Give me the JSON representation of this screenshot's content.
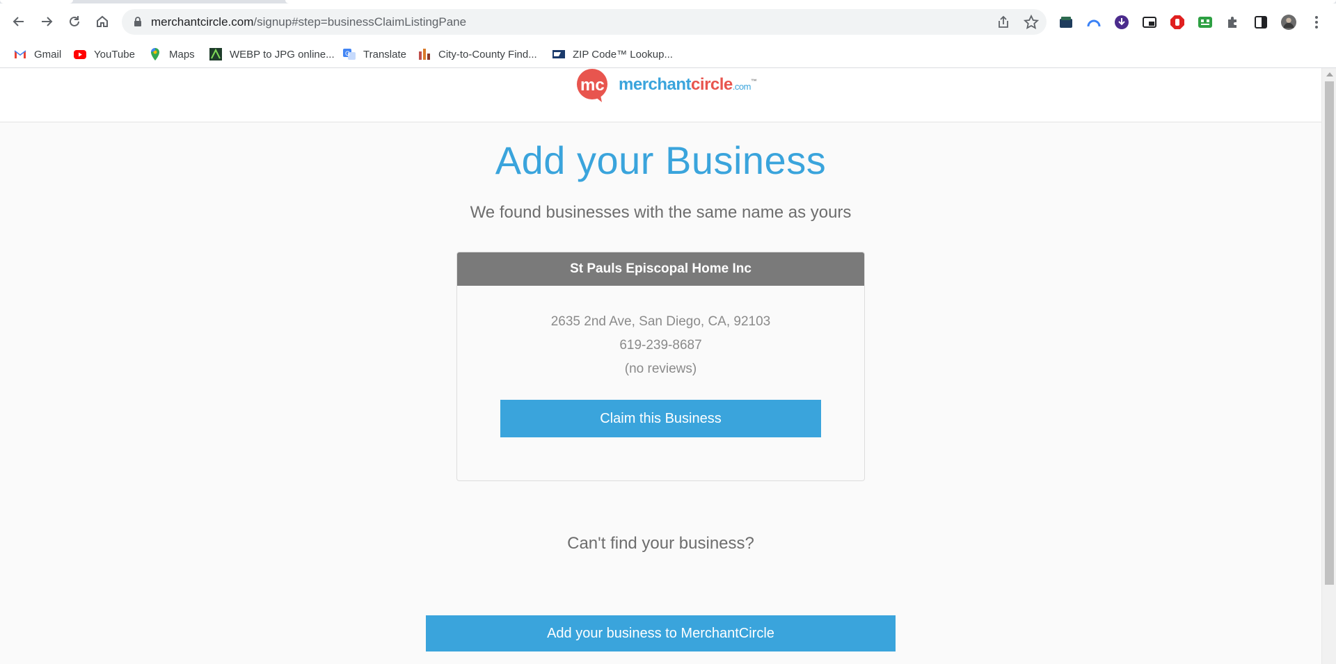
{
  "browser": {
    "url_host": "merchantcircle.com",
    "url_path": "/signup#step=businessClaimListingPane",
    "bookmarks": [
      {
        "label": "Gmail",
        "icon": "gmail-icon"
      },
      {
        "label": "YouTube",
        "icon": "youtube-icon"
      },
      {
        "label": "Maps",
        "icon": "maps-icon"
      },
      {
        "label": "WEBP to JPG online...",
        "icon": "webp-converter-icon"
      },
      {
        "label": "Translate",
        "icon": "translate-icon"
      },
      {
        "label": "City-to-County Find...",
        "icon": "city-county-icon"
      },
      {
        "label": "ZIP Code™ Lookup...",
        "icon": "usps-icon"
      }
    ]
  },
  "site": {
    "logo_badge": "mc",
    "logo_merchant": "merchant",
    "logo_circle": "circle",
    "logo_domain": ".com",
    "logo_tm": "™"
  },
  "page": {
    "title": "Add your Business",
    "subtitle": "We found businesses with the same name as yours",
    "listing": {
      "name": "St Pauls Episcopal Home Inc",
      "address": "2635 2nd Ave, San Diego, CA, 92103",
      "phone": "619-239-8687",
      "reviews": "(no reviews)",
      "claim_label": "Claim this Business"
    },
    "cant_find": "Can't find your business?",
    "add_label": "Add your business to MerchantCircle"
  },
  "colors": {
    "accent": "#3aa4dc",
    "brand_red": "#e8554e",
    "card_header": "#7a7a7a"
  }
}
